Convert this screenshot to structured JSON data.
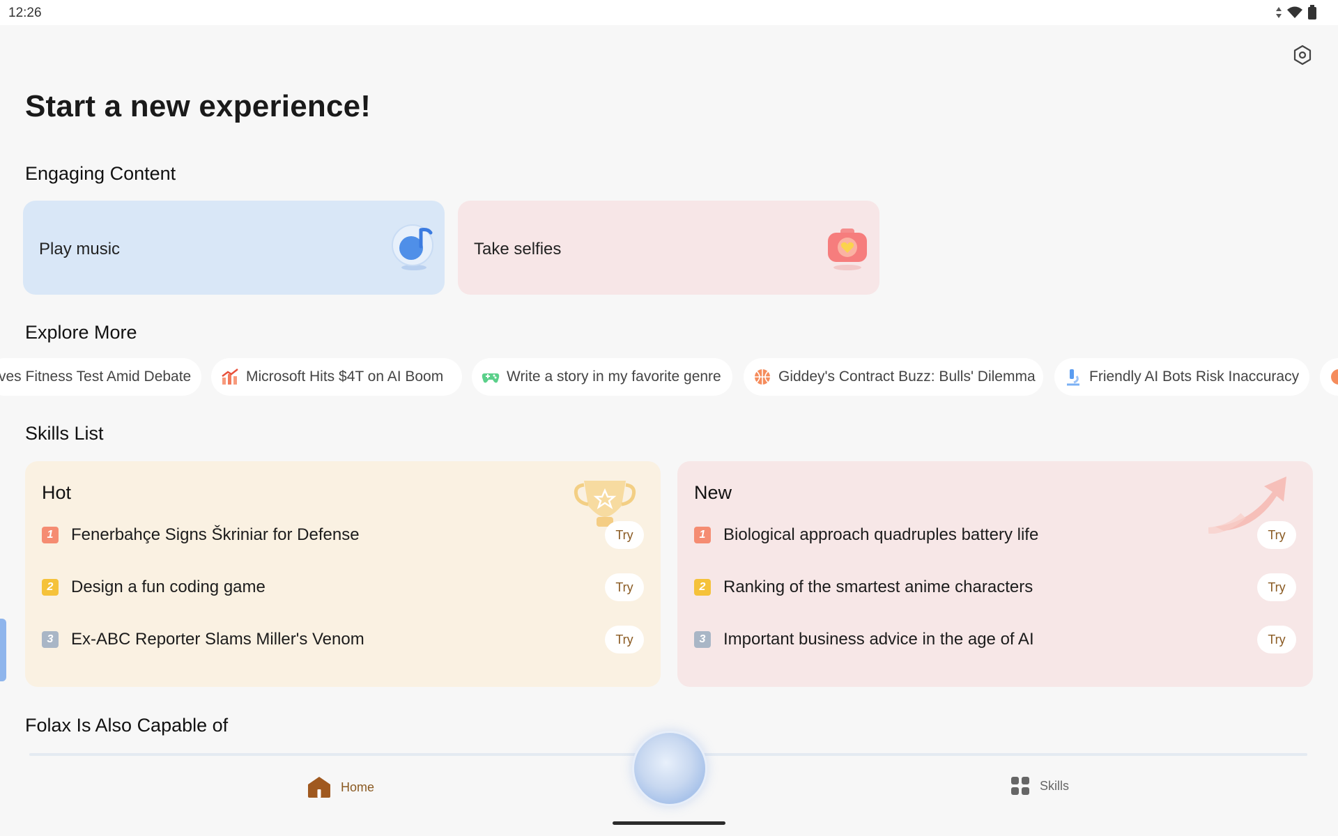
{
  "status_bar": {
    "time": "12:26"
  },
  "page": {
    "title": "Start a new experience!"
  },
  "sections": {
    "engaging": "Engaging Content",
    "explore": "Explore More",
    "skills": "Skills List",
    "capable": "Folax Is Also Capable of"
  },
  "engaging_cards": [
    {
      "label": "Play music",
      "icon": "music-note-icon",
      "color": "#d9e7f7"
    },
    {
      "label": "Take selfies",
      "icon": "camera-heart-icon",
      "color": "#f7e6e7"
    }
  ],
  "explore_chips": [
    {
      "label": "ves Fitness Test Amid Debate",
      "icon": ""
    },
    {
      "label": "Microsoft Hits $4T on AI Boom",
      "icon": "chart-up-icon"
    },
    {
      "label": "Write a story in my favorite genre",
      "icon": "gamepad-icon"
    },
    {
      "label": "Giddey's Contract Buzz: Bulls' Dilemma",
      "icon": "basketball-icon"
    },
    {
      "label": "Friendly AI Bots Risk Inaccuracy",
      "icon": "microscope-icon"
    }
  ],
  "skills": {
    "hot": {
      "title": "Hot",
      "color": "#faf1e2",
      "items": [
        {
          "rank": "1",
          "text": "Fenerbahçe Signs Škriniar for Defense",
          "action": "Try"
        },
        {
          "rank": "2",
          "text": "Design a fun coding game",
          "action": "Try"
        },
        {
          "rank": "3",
          "text": "Ex-ABC Reporter Slams Miller's Venom",
          "action": "Try"
        }
      ]
    },
    "new": {
      "title": "New",
      "color": "#f7e7e7",
      "items": [
        {
          "rank": "1",
          "text": "Biological approach quadruples battery life",
          "action": "Try"
        },
        {
          "rank": "2",
          "text": "Ranking of the smartest anime characters",
          "action": "Try"
        },
        {
          "rank": "3",
          "text": "Important business advice in the age of AI",
          "action": "Try"
        }
      ]
    }
  },
  "rank_colors": [
    "#f58c72",
    "#f5c23a",
    "#a9b6c6"
  ],
  "nav": {
    "home": "Home",
    "skills": "Skills",
    "accent": "#8a5a22"
  }
}
